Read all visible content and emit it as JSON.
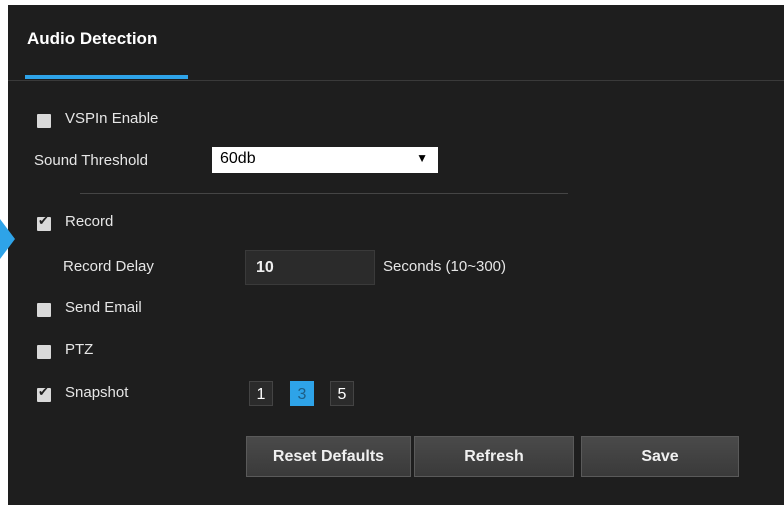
{
  "header": {
    "title": "Audio Detection"
  },
  "vspin": {
    "label": "VSPIn Enable",
    "checked": false
  },
  "sound_threshold": {
    "label": "Sound Threshold",
    "value": "60db",
    "arrow": "▼"
  },
  "record": {
    "label": "Record",
    "checked": true
  },
  "record_delay": {
    "label": "Record Delay",
    "value": "10",
    "unit": "Seconds (10~300)"
  },
  "send_email": {
    "label": "Send Email",
    "checked": false
  },
  "ptz": {
    "label": "PTZ",
    "checked": false
  },
  "snapshot": {
    "label": "Snapshot",
    "checked": true,
    "options": [
      "1",
      "3",
      "5"
    ],
    "selected": "3"
  },
  "buttons": {
    "reset": "Reset Defaults",
    "refresh": "Refresh",
    "save": "Save"
  },
  "colors": {
    "accent": "#2ea3e8",
    "background": "#1e1e1e"
  }
}
